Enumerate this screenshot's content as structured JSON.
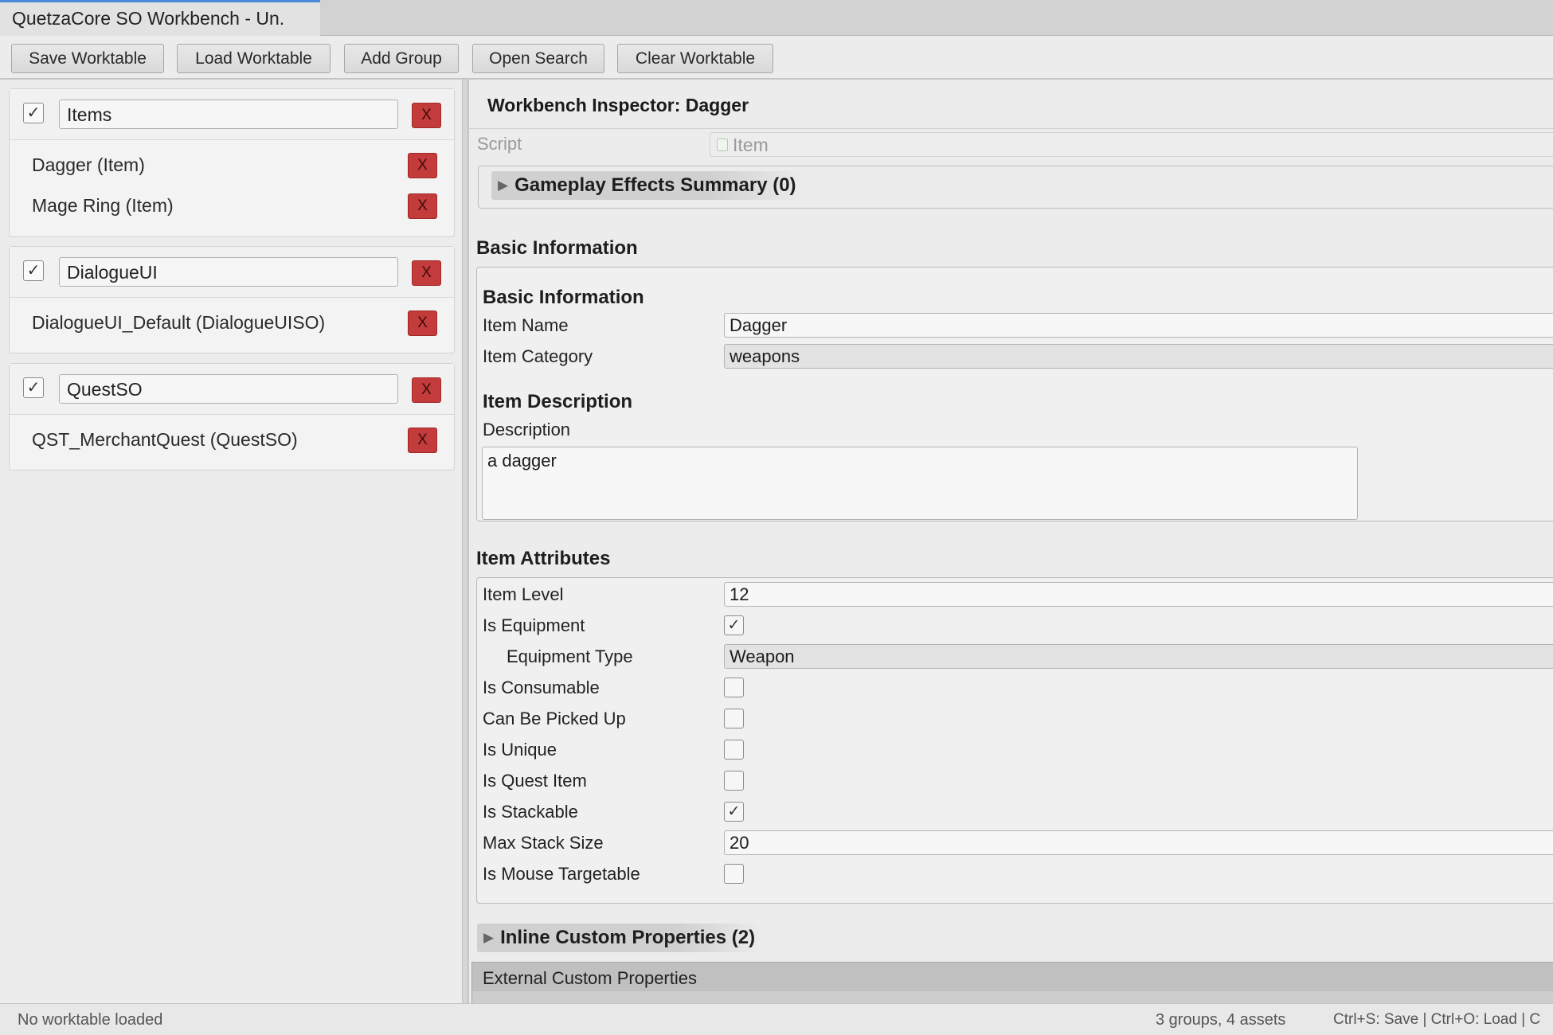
{
  "window": {
    "title": "QuetzaCore SO Workbench - Un."
  },
  "toolbar": {
    "save": "Save Worktable",
    "load": "Load Worktable",
    "add_group": "Add Group",
    "open_search": "Open Search",
    "clear": "Clear Worktable"
  },
  "groups": [
    {
      "name": "Items",
      "checked": "✓",
      "remove": "X",
      "assets": [
        {
          "label": "Dagger (Item)",
          "remove": "X"
        },
        {
          "label": "Mage Ring (Item)",
          "remove": "X"
        }
      ]
    },
    {
      "name": "DialogueUI",
      "checked": "✓",
      "remove": "X",
      "assets": [
        {
          "label": "DialogueUI_Default (DialogueUISO)",
          "remove": "X"
        }
      ]
    },
    {
      "name": "QuestSO",
      "checked": "✓",
      "remove": "X",
      "assets": [
        {
          "label": "QST_MerchantQuest (QuestSO)",
          "remove": "X"
        }
      ]
    }
  ],
  "inspector": {
    "title": "Workbench Inspector: Dagger",
    "script_label": "Script",
    "script_value": "Item",
    "gameplay_effects": "Gameplay Effects Summary (0)",
    "basic_section": "Basic Information",
    "basic_header": "Basic Information",
    "item_name_label": "Item Name",
    "item_name_value": "Dagger",
    "item_category_label": "Item Category",
    "item_category_value": "weapons",
    "description_header": "Item Description",
    "description_label": "Description",
    "description_value": "a dagger",
    "attributes_section": "Item Attributes",
    "attributes": {
      "item_level_label": "Item Level",
      "item_level_value": "12",
      "is_equipment_label": "Is Equipment",
      "is_equipment_value": "✓",
      "equipment_type_label": "Equipment Type",
      "equipment_type_value": "Weapon",
      "is_consumable_label": "Is Consumable",
      "can_be_picked_up_label": "Can Be Picked Up",
      "is_unique_label": "Is Unique",
      "is_quest_item_label": "Is Quest Item",
      "is_stackable_label": "Is Stackable",
      "is_stackable_value": "✓",
      "max_stack_size_label": "Max Stack Size",
      "max_stack_size_value": "20",
      "is_mouse_targetable_label": "Is Mouse Targetable"
    },
    "inline_custom": "Inline Custom Properties (2)",
    "external_custom": "External Custom Properties"
  },
  "status": {
    "left": "No worktable loaded",
    "counts": "3 groups, 4 assets",
    "shortcuts": "Ctrl+S: Save | Ctrl+O: Load | C"
  },
  "colors": {
    "accent": "#4a88d8",
    "remove_button": "#c43b3b"
  }
}
